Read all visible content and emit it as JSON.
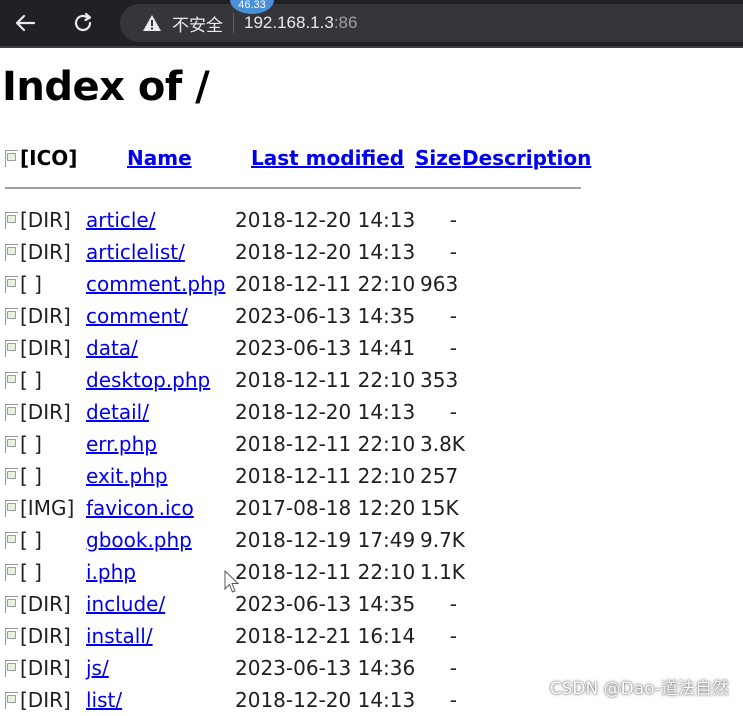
{
  "browser": {
    "security_label": "不安全",
    "url_host": "192.168.1.3",
    "url_port": ":86",
    "overlay_badge": "46.33"
  },
  "page": {
    "title": "Index of /",
    "headers": {
      "icon": "[ICO]",
      "name": "Name",
      "last_modified": "Last modified",
      "size": "Size",
      "description": "Description"
    },
    "rows": [
      {
        "icon": "[DIR]",
        "name": "article/",
        "modified": "2018-12-20 14:13",
        "size": "-"
      },
      {
        "icon": "[DIR]",
        "name": "articlelist/",
        "modified": "2018-12-20 14:13",
        "size": "-"
      },
      {
        "icon": "[ ]",
        "name": "comment.php",
        "modified": "2018-12-11 22:10",
        "size": "963"
      },
      {
        "icon": "[DIR]",
        "name": "comment/",
        "modified": "2023-06-13 14:35",
        "size": "-"
      },
      {
        "icon": "[DIR]",
        "name": "data/",
        "modified": "2023-06-13 14:41",
        "size": "-"
      },
      {
        "icon": "[ ]",
        "name": "desktop.php",
        "modified": "2018-12-11 22:10",
        "size": "353"
      },
      {
        "icon": "[DIR]",
        "name": "detail/",
        "modified": "2018-12-20 14:13",
        "size": "-"
      },
      {
        "icon": "[ ]",
        "name": "err.php",
        "modified": "2018-12-11 22:10",
        "size": "3.8K"
      },
      {
        "icon": "[ ]",
        "name": "exit.php",
        "modified": "2018-12-11 22:10",
        "size": "257"
      },
      {
        "icon": "[IMG]",
        "name": "favicon.ico",
        "modified": "2017-08-18 12:20",
        "size": "15K"
      },
      {
        "icon": "[ ]",
        "name": "gbook.php",
        "modified": "2018-12-19 17:49",
        "size": "9.7K"
      },
      {
        "icon": "[ ]",
        "name": "i.php",
        "modified": "2018-12-11 22:10",
        "size": "1.1K"
      },
      {
        "icon": "[DIR]",
        "name": "include/",
        "modified": "2023-06-13 14:35",
        "size": "-"
      },
      {
        "icon": "[DIR]",
        "name": "install/",
        "modified": "2018-12-21 16:14",
        "size": "-"
      },
      {
        "icon": "[DIR]",
        "name": "js/",
        "modified": "2023-06-13 14:36",
        "size": "-"
      },
      {
        "icon": "[DIR]",
        "name": "list/",
        "modified": "2018-12-20 14:13",
        "size": "-"
      }
    ]
  },
  "watermark": "CSDN @Dao-道法自然"
}
